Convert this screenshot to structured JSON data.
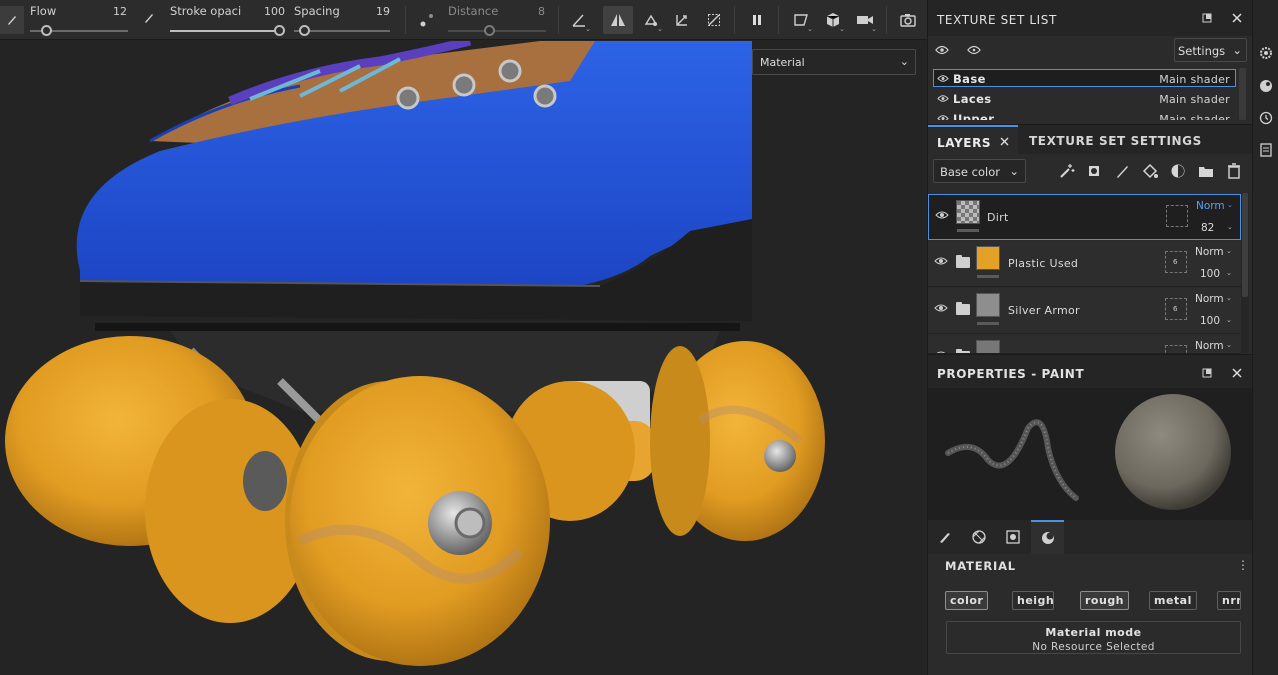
{
  "toolbar": {
    "flow_label": "Flow",
    "flow_value": "12",
    "stroke_label": "Stroke opaci",
    "stroke_value": "100",
    "spacing_label": "Spacing",
    "spacing_value": "19",
    "distance_label": "Distance",
    "distance_value": "8"
  },
  "viewport": {
    "display_mode": "Material"
  },
  "texture_set_list": {
    "title": "TEXTURE SET LIST",
    "settings_label": "Settings",
    "rows": [
      {
        "name": "Base",
        "shader": "Main shader"
      },
      {
        "name": "Laces",
        "shader": "Main shader"
      },
      {
        "name": "Upper",
        "shader": "Main shader"
      }
    ]
  },
  "layers": {
    "tab_layers": "LAYERS",
    "tab_texture_set_settings": "TEXTURE SET SETTINGS",
    "channel": "Base color",
    "items": [
      {
        "name": "Dirt",
        "blend": "Norm",
        "opacity": "82",
        "color": "#8a8a8a"
      },
      {
        "name": "Plastic Used",
        "blend": "Norm",
        "opacity": "100",
        "color": "#e3a227",
        "mask_count": "6"
      },
      {
        "name": "Silver Armor",
        "blend": "Norm",
        "opacity": "100",
        "color": "#8e8e8e",
        "mask_count": "6"
      },
      {
        "name": "",
        "blend": "Norm",
        "opacity": "",
        "color": "#777777"
      }
    ]
  },
  "properties": {
    "title": "PROPERTIES - PAINT",
    "material_title": "MATERIAL",
    "channels": [
      "color",
      "height",
      "rough",
      "metal",
      "nrm"
    ],
    "material_mode_title": "Material mode",
    "material_mode_value": "No Resource Selected"
  },
  "colors": {
    "accent": "#4f8fe0",
    "wheel": "#e3a227",
    "boot": "#2556d8"
  }
}
